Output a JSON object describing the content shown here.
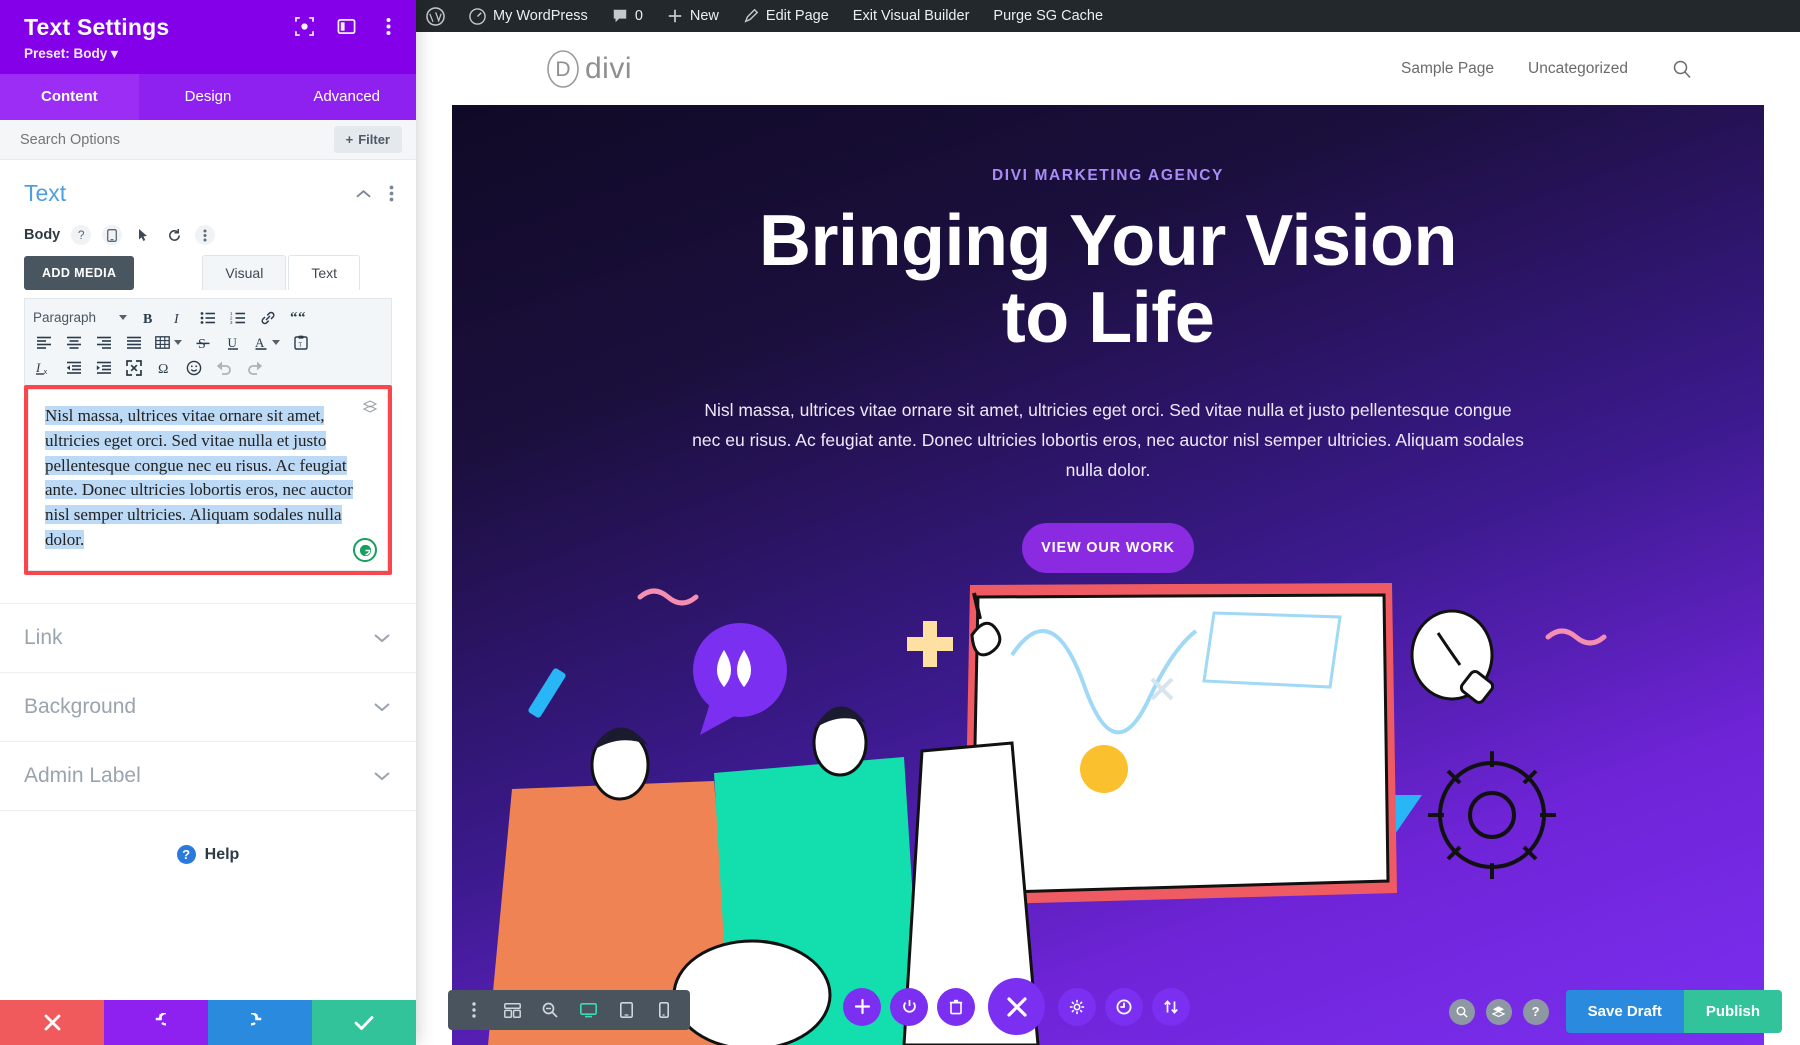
{
  "sidebar": {
    "title": "Text Settings",
    "preset": "Preset: Body",
    "preset_caret": "▾",
    "header_icons": [
      {
        "name": "focus-icon",
        "label": "Focus"
      },
      {
        "name": "layout-panel-icon",
        "label": "Panel Layout"
      },
      {
        "name": "kebab-menu-icon",
        "label": "More"
      }
    ],
    "tabs": [
      {
        "label": "Content",
        "active": true
      },
      {
        "label": "Design",
        "active": false
      },
      {
        "label": "Advanced",
        "active": false
      }
    ],
    "search_placeholder": "Search Options",
    "filter_label": "Filter",
    "filter_plus": "+",
    "section": {
      "title": "Text",
      "collapse_icon": "chevron-up-icon",
      "menu_icon": "kebab-menu-icon"
    },
    "field": {
      "label": "Body",
      "icons": [
        "help-icon",
        "responsive-icon",
        "hover-icon",
        "reset-icon",
        "kebab-menu-icon"
      ]
    },
    "add_media_label": "ADD MEDIA",
    "editor_tabs": [
      {
        "label": "Visual",
        "active": true
      },
      {
        "label": "Text",
        "active": false
      }
    ],
    "editor_toolbar": {
      "format_select": "Paragraph",
      "row1": [
        "bold-icon",
        "italic-icon",
        "bulleted-list-icon",
        "numbered-list-icon",
        "link-icon",
        "blockquote-icon"
      ],
      "row2": [
        "align-left-icon",
        "align-center-icon",
        "align-right-icon",
        "align-justify-icon",
        "table-icon",
        "strikethrough-icon",
        "underline-icon",
        "text-color-icon",
        "paste-text-icon"
      ],
      "row3": [
        "clear-formatting-icon",
        "outdent-icon",
        "indent-icon",
        "fullscreen-icon",
        "special-character-icon",
        "emoji-icon",
        "undo-icon",
        "redo-icon"
      ]
    },
    "editor_content": "Nisl massa, ultrices vitae ornare sit amet, ultricies eget orci. Sed vitae nulla et justo pellentesque congue nec eu risus. Ac feugiat ante. Donec ultricies lobortis eros, nec auctor nisl semper ultricies. Aliquam sodales nulla dolor.",
    "editor_selected": true,
    "editor_highlight_color": "#bcd9f5",
    "editor_outline_color": "#f8464c",
    "accordions": [
      {
        "label": "Link",
        "icon": "chevron-down-icon"
      },
      {
        "label": "Background",
        "icon": "chevron-down-icon"
      },
      {
        "label": "Admin Label",
        "icon": "chevron-down-icon"
      }
    ],
    "help_label": "Help",
    "footer_buttons": [
      {
        "name": "cancel-button",
        "icon": "close-icon",
        "color": "#f05a5c"
      },
      {
        "name": "undo-button",
        "icon": "undo-icon",
        "color": "#8f21f0"
      },
      {
        "name": "redo-button",
        "icon": "redo-icon",
        "color": "#2a8ade"
      },
      {
        "name": "save-button",
        "icon": "check-icon",
        "color": "#32c39a"
      }
    ]
  },
  "wp_adminbar": {
    "items": [
      {
        "label": "",
        "icon": "wordpress-logo-icon"
      },
      {
        "label": "My WordPress",
        "icon": "dashboard-icon"
      },
      {
        "label": "0",
        "icon": "comment-icon"
      },
      {
        "label": "New",
        "icon": "plus-icon"
      },
      {
        "label": "Edit Page",
        "icon": "pencil-icon"
      },
      {
        "label": "Exit Visual Builder",
        "icon": ""
      },
      {
        "label": "Purge SG Cache",
        "icon": ""
      }
    ]
  },
  "site": {
    "logo_text": "divi",
    "logo_mark": "D",
    "nav": [
      {
        "label": "Sample Page"
      },
      {
        "label": "Uncategorized"
      }
    ],
    "search_icon": "search-icon",
    "hero": {
      "eyebrow": "DIVI MARKETING AGENCY",
      "title_line1": "Bringing Your Vision",
      "title_line2": "to Life",
      "subtitle": "Nisl massa, ultrices vitae ornare sit amet, ultricies eget orci. Sed vitae nulla et justo pellentesque congue nec eu risus. Ac feugiat ante. Donec ultricies lobortis eros, nec auctor nisl semper ultricies. Aliquam sodales nulla dolor.",
      "button_label": "VIEW OUR WORK",
      "accent_color": "#8a2be2",
      "eyebrow_color": "#a98cf5"
    }
  },
  "builder_bars": {
    "view_bar": [
      {
        "name": "kebab-menu-icon",
        "active": false
      },
      {
        "name": "wireframe-icon",
        "active": false
      },
      {
        "name": "zoom-out-icon",
        "active": false
      },
      {
        "name": "desktop-icon",
        "active": true
      },
      {
        "name": "tablet-icon",
        "active": false
      },
      {
        "name": "phone-icon",
        "active": false
      }
    ],
    "main_bar": [
      {
        "name": "add-section-icon",
        "size": "sm"
      },
      {
        "name": "power-icon",
        "size": "sm"
      },
      {
        "name": "trash-icon",
        "size": "sm"
      },
      {
        "name": "close-icon",
        "size": "lg"
      },
      {
        "name": "settings-gear-icon",
        "size": "sm"
      },
      {
        "name": "history-clock-icon",
        "size": "sm"
      },
      {
        "name": "portability-icon",
        "size": "sm"
      }
    ],
    "right_bar": [
      {
        "name": "search-icon"
      },
      {
        "name": "layers-icon"
      },
      {
        "name": "help-icon"
      }
    ],
    "save_draft_label": "Save Draft",
    "publish_label": "Publish",
    "save_draft_color": "#2a8ade",
    "publish_color": "#32c39a"
  }
}
